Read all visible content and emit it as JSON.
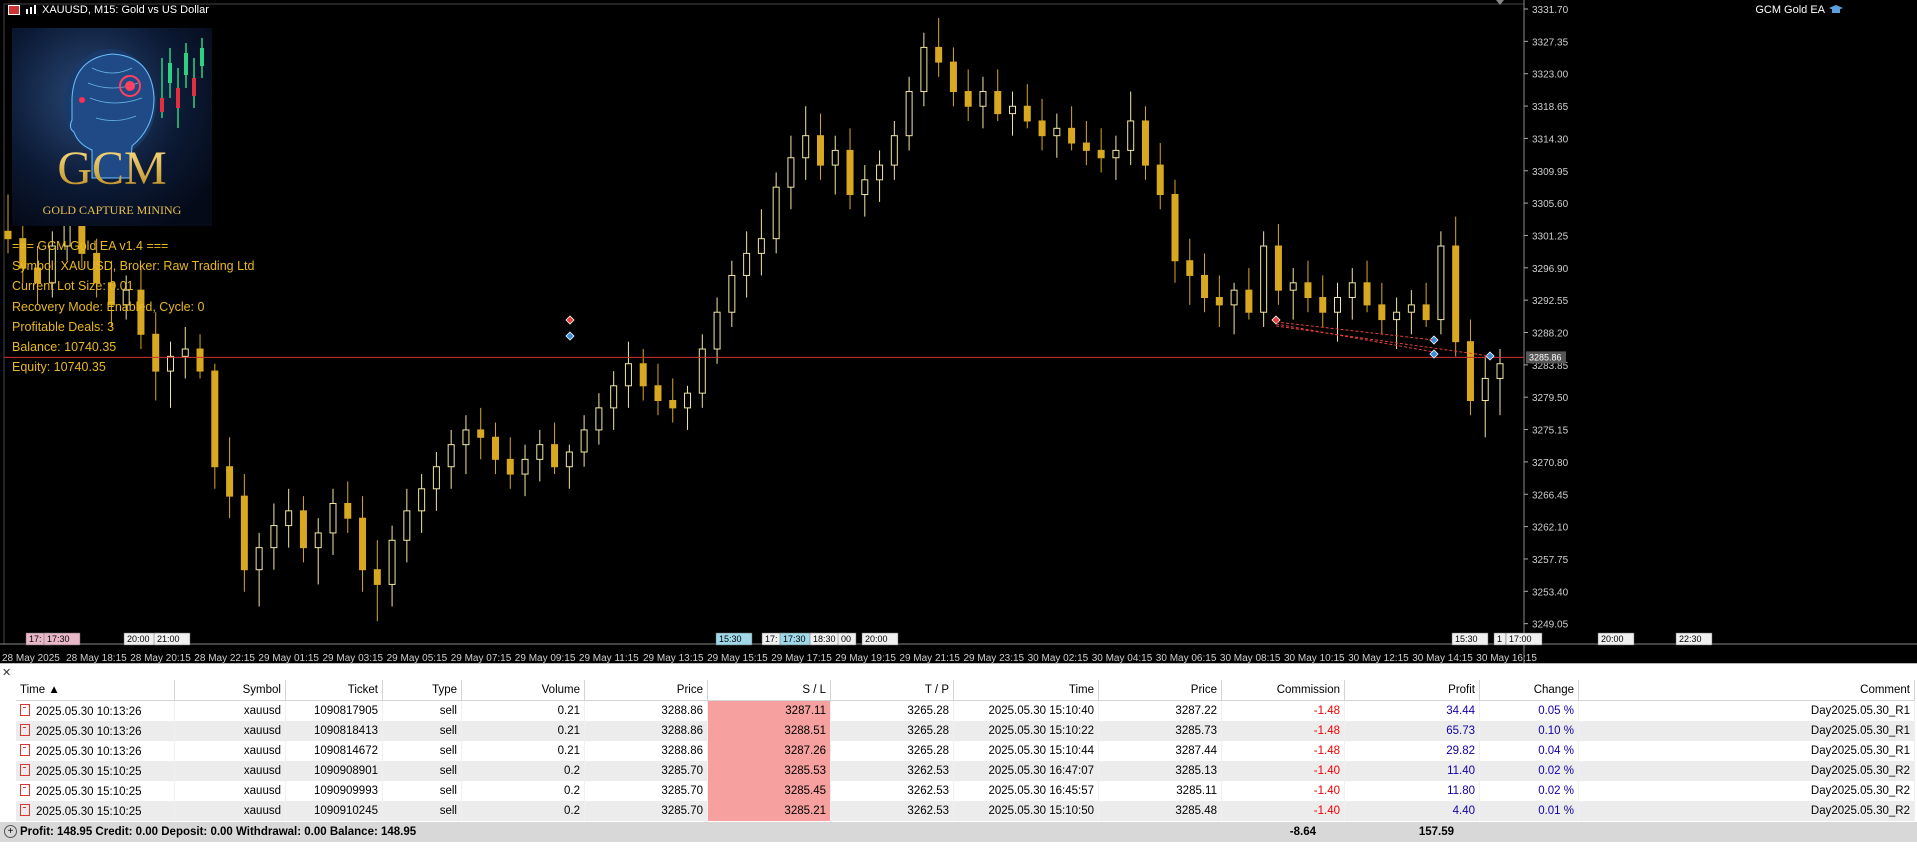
{
  "chart": {
    "title": "XAUUSD, M15:  Gold vs US Dollar",
    "ea_name": "GCM Gold EA",
    "logo": {
      "big": "GCM",
      "small": "GOLD CAPTURE MINING"
    },
    "current_price": "3285.86",
    "price_axis": [
      "3331.70",
      "3327.35",
      "3323.00",
      "3318.65",
      "3314.30",
      "3309.95",
      "3305.60",
      "3301.25",
      "3296.90",
      "3292.55",
      "3288.20",
      "3283.85",
      "3279.50",
      "3275.15",
      "3270.80",
      "3266.45",
      "3262.10",
      "3257.75",
      "3253.40",
      "3249.05"
    ],
    "time_axis": [
      "28 May 2025",
      "28 May 18:15",
      "28 May 20:15",
      "28 May 22:15",
      "29 May 01:15",
      "29 May 03:15",
      "29 May 05:15",
      "29 May 07:15",
      "29 May 09:15",
      "29 May 11:15",
      "29 May 13:15",
      "29 May 15:15",
      "29 May 17:15",
      "29 May 19:15",
      "29 May 21:15",
      "29 May 23:15",
      "30 May 02:15",
      "30 May 04:15",
      "30 May 06:15",
      "30 May 08:15",
      "30 May 10:15",
      "30 May 12:15",
      "30 May 14:15",
      "30 May 16:15"
    ],
    "session_labels": [
      "17:",
      "17:30",
      "20:00",
      "21:00",
      "15:30",
      "17:",
      "17:30",
      "18:30",
      "00",
      "20:00",
      "15:30",
      "1",
      "17:00",
      "20:00",
      "22:30"
    ]
  },
  "chart_data": {
    "type": "candlestick",
    "symbol": "XAUUSD",
    "timeframe": "M15",
    "ylim": [
      3246.9,
      3333.9
    ],
    "candles": [
      [
        3303,
        3308,
        3300,
        3302
      ],
      [
        3302,
        3304,
        3296,
        3298
      ],
      [
        3298,
        3301,
        3293,
        3296
      ],
      [
        3296,
        3303,
        3294,
        3301
      ],
      [
        3301,
        3307,
        3299,
        3304
      ],
      [
        3304,
        3306,
        3298,
        3300
      ],
      [
        3300,
        3302,
        3294,
        3296
      ],
      [
        3296,
        3299,
        3290,
        3293
      ],
      [
        3293,
        3297,
        3291,
        3295
      ],
      [
        3295,
        3298,
        3287,
        3289
      ],
      [
        3289,
        3292,
        3280,
        3284
      ],
      [
        3284,
        3288,
        3279,
        3286
      ],
      [
        3286,
        3290,
        3283,
        3287
      ],
      [
        3287,
        3289,
        3283,
        3284
      ],
      [
        3284,
        3285,
        3268,
        3271
      ],
      [
        3271,
        3275,
        3264,
        3267
      ],
      [
        3267,
        3270,
        3254,
        3257
      ],
      [
        3257,
        3262,
        3252,
        3260
      ],
      [
        3260,
        3266,
        3257,
        3263
      ],
      [
        3263,
        3268,
        3260,
        3265
      ],
      [
        3265,
        3267,
        3258,
        3260
      ],
      [
        3260,
        3264,
        3255,
        3262
      ],
      [
        3262,
        3268,
        3259,
        3266
      ],
      [
        3266,
        3269,
        3262,
        3264
      ],
      [
        3264,
        3267,
        3254,
        3257
      ],
      [
        3257,
        3261,
        3250,
        3255
      ],
      [
        3255,
        3263,
        3252,
        3261
      ],
      [
        3261,
        3268,
        3258,
        3265
      ],
      [
        3265,
        3270,
        3262,
        3268
      ],
      [
        3268,
        3273,
        3265,
        3271
      ],
      [
        3271,
        3276,
        3268,
        3274
      ],
      [
        3274,
        3278,
        3270,
        3276
      ],
      [
        3276,
        3279,
        3272,
        3275
      ],
      [
        3275,
        3277,
        3270,
        3272
      ],
      [
        3272,
        3275,
        3268,
        3270
      ],
      [
        3270,
        3274,
        3267,
        3272
      ],
      [
        3272,
        3276,
        3269,
        3274
      ],
      [
        3274,
        3277,
        3270,
        3271
      ],
      [
        3271,
        3274,
        3268,
        3273
      ],
      [
        3273,
        3278,
        3271,
        3276
      ],
      [
        3276,
        3281,
        3274,
        3279
      ],
      [
        3279,
        3284,
        3276,
        3282
      ],
      [
        3282,
        3288,
        3279,
        3285
      ],
      [
        3285,
        3287,
        3280,
        3282
      ],
      [
        3282,
        3285,
        3278,
        3280
      ],
      [
        3280,
        3283,
        3277,
        3279
      ],
      [
        3279,
        3282,
        3276,
        3281
      ],
      [
        3281,
        3289,
        3279,
        3287
      ],
      [
        3287,
        3294,
        3285,
        3292
      ],
      [
        3292,
        3299,
        3290,
        3297
      ],
      [
        3297,
        3303,
        3294,
        3300
      ],
      [
        3300,
        3306,
        3297,
        3302
      ],
      [
        3302,
        3311,
        3300,
        3309
      ],
      [
        3309,
        3316,
        3306,
        3313
      ],
      [
        3313,
        3320,
        3310,
        3316
      ],
      [
        3316,
        3319,
        3310,
        3312
      ],
      [
        3312,
        3316,
        3308,
        3314
      ],
      [
        3314,
        3317,
        3306,
        3308
      ],
      [
        3308,
        3312,
        3305,
        3310
      ],
      [
        3310,
        3314,
        3307,
        3312
      ],
      [
        3312,
        3318,
        3310,
        3316
      ],
      [
        3316,
        3324,
        3314,
        3322
      ],
      [
        3322,
        3330,
        3320,
        3328
      ],
      [
        3328,
        3332,
        3324,
        3326
      ],
      [
        3326,
        3328,
        3320,
        3322
      ],
      [
        3322,
        3325,
        3318,
        3320
      ],
      [
        3320,
        3324,
        3317,
        3322
      ],
      [
        3322,
        3325,
        3318,
        3319
      ],
      [
        3319,
        3322,
        3316,
        3320
      ],
      [
        3320,
        3323,
        3317,
        3318
      ],
      [
        3318,
        3321,
        3314,
        3316
      ],
      [
        3316,
        3319,
        3313,
        3317
      ],
      [
        3317,
        3320,
        3314,
        3315
      ],
      [
        3315,
        3318,
        3312,
        3314
      ],
      [
        3314,
        3317,
        3311,
        3313
      ],
      [
        3313,
        3316,
        3310,
        3314
      ],
      [
        3314,
        3322,
        3312,
        3318
      ],
      [
        3318,
        3320,
        3310,
        3312
      ],
      [
        3312,
        3315,
        3306,
        3308
      ],
      [
        3308,
        3310,
        3296,
        3299
      ],
      [
        3299,
        3302,
        3293,
        3297
      ],
      [
        3297,
        3300,
        3292,
        3294
      ],
      [
        3294,
        3297,
        3290,
        3293
      ],
      [
        3293,
        3296,
        3289,
        3295
      ],
      [
        3295,
        3298,
        3291,
        3292
      ],
      [
        3292,
        3303,
        3290,
        3301
      ],
      [
        3301,
        3304,
        3293,
        3295
      ],
      [
        3295,
        3298,
        3291,
        3296
      ],
      [
        3296,
        3299,
        3292,
        3294
      ],
      [
        3294,
        3297,
        3290,
        3292
      ],
      [
        3292,
        3296,
        3288,
        3294
      ],
      [
        3294,
        3298,
        3291,
        3296
      ],
      [
        3296,
        3299,
        3292,
        3293
      ],
      [
        3293,
        3296,
        3289,
        3291
      ],
      [
        3291,
        3294,
        3287,
        3292
      ],
      [
        3292,
        3295,
        3289,
        3293
      ],
      [
        3293,
        3296,
        3290,
        3291
      ],
      [
        3291,
        3303,
        3289,
        3301
      ],
      [
        3301,
        3305,
        3286,
        3288
      ],
      [
        3288,
        3291,
        3278,
        3280
      ],
      [
        3280,
        3286,
        3275,
        3283
      ],
      [
        3283,
        3287,
        3278,
        3285
      ]
    ],
    "horizontal_line": 3285.86
  },
  "terminal": {
    "headers": [
      "Time",
      "Symbol",
      "Ticket",
      "Type",
      "Volume",
      "Price",
      "S / L",
      "T / P",
      "Time",
      "Price",
      "Commission",
      "Profit",
      "Change",
      "Comment"
    ],
    "rows": [
      {
        "time": "2025.05.30 10:13:26",
        "symbol": "xauusd",
        "ticket": "1090817905",
        "type": "sell",
        "volume": "0.21",
        "price": "3288.86",
        "sl": "3287.11",
        "tp": "3265.28",
        "time2": "2025.05.30 15:10:40",
        "price2": "3287.22",
        "commission": "-1.48",
        "profit": "34.44",
        "change": "0.05 %",
        "comment": "Day2025.05.30_R1"
      },
      {
        "time": "2025.05.30 10:13:26",
        "symbol": "xauusd",
        "ticket": "1090818413",
        "type": "sell",
        "volume": "0.21",
        "price": "3288.86",
        "sl": "3288.51",
        "tp": "3265.28",
        "time2": "2025.05.30 15:10:22",
        "price2": "3285.73",
        "commission": "-1.48",
        "profit": "65.73",
        "change": "0.10 %",
        "comment": "Day2025.05.30_R1"
      },
      {
        "time": "2025.05.30 10:13:26",
        "symbol": "xauusd",
        "ticket": "1090814672",
        "type": "sell",
        "volume": "0.21",
        "price": "3288.86",
        "sl": "3287.26",
        "tp": "3265.28",
        "time2": "2025.05.30 15:10:44",
        "price2": "3287.44",
        "commission": "-1.48",
        "profit": "29.82",
        "change": "0.04 %",
        "comment": "Day2025.05.30_R1"
      },
      {
        "time": "2025.05.30 15:10:25",
        "symbol": "xauusd",
        "ticket": "1090908901",
        "type": "sell",
        "volume": "0.2",
        "price": "3285.70",
        "sl": "3285.53",
        "tp": "3262.53",
        "time2": "2025.05.30 16:47:07",
        "price2": "3285.13",
        "commission": "-1.40",
        "profit": "11.40",
        "change": "0.02 %",
        "comment": "Day2025.05.30_R2"
      },
      {
        "time": "2025.05.30 15:10:25",
        "symbol": "xauusd",
        "ticket": "1090909993",
        "type": "sell",
        "volume": "0.2",
        "price": "3285.70",
        "sl": "3285.45",
        "tp": "3262.53",
        "time2": "2025.05.30 16:45:57",
        "price2": "3285.11",
        "commission": "-1.40",
        "profit": "11.80",
        "change": "0.02 %",
        "comment": "Day2025.05.30_R2"
      },
      {
        "time": "2025.05.30 15:10:25",
        "symbol": "xauusd",
        "ticket": "1090910245",
        "type": "sell",
        "volume": "0.2",
        "price": "3285.70",
        "sl": "3285.21",
        "tp": "3262.53",
        "time2": "2025.05.30 15:10:50",
        "price2": "3285.48",
        "commission": "-1.40",
        "profit": "4.40",
        "change": "0.01 %",
        "comment": "Day2025.05.30_R2"
      }
    ],
    "summary": {
      "text": "Profit: 148.95  Credit: 0.00  Deposit: 0.00  Withdrawal: 0.00  Balance: 148.95",
      "commission": "-8.64",
      "profit": "157.59"
    }
  },
  "info_lines": [
    "=== GCM Gold EA v1.4 ===",
    "Symbol: XAUUSD, Broker: Raw Trading Ltd",
    "Current Lot Size: 0.01",
    "Recovery Mode: Enabled, Cycle: 0",
    "Profitable Deals: 3",
    "Balance: 10740.35",
    "Equity: 10740.35"
  ],
  "colors": {
    "bull": "#f0e6a0",
    "bear": "#d8a820",
    "info_text": "#e8b820",
    "price_line": "#d03030",
    "loss": "#e00000",
    "profit": "#1010aa",
    "sl_bg": "#f6a0a0"
  }
}
